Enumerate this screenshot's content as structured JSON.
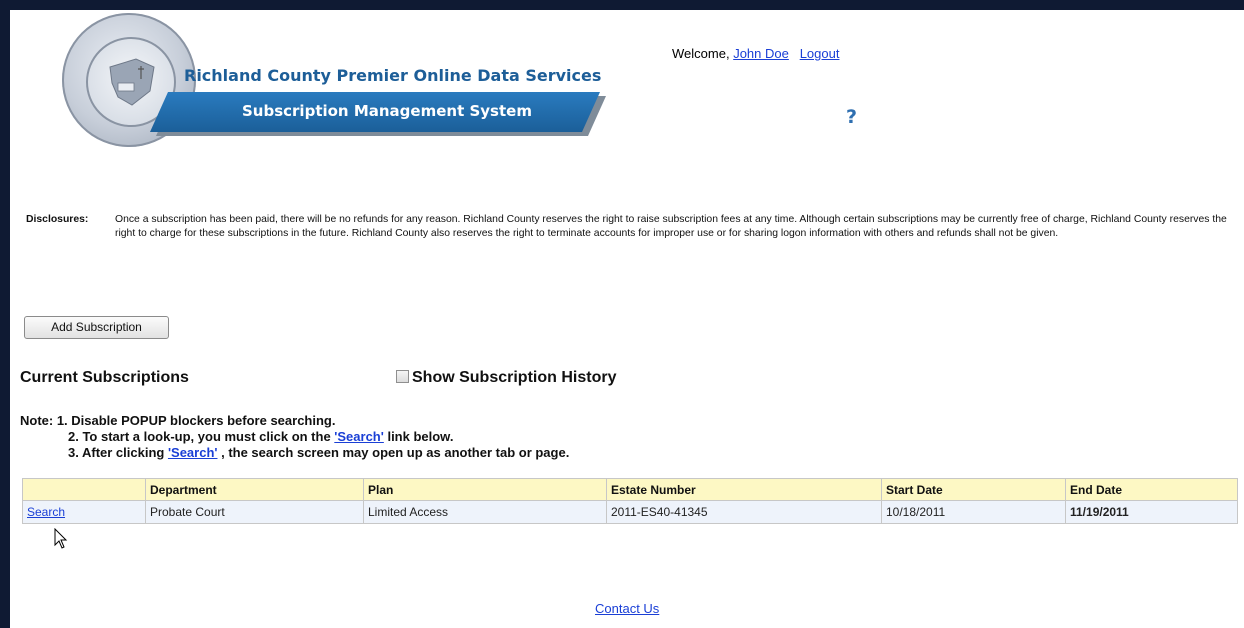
{
  "header": {
    "title_line1": "Richland County Premier Online Data Services",
    "title_line2": "Subscription Management System",
    "welcome_prefix": "Welcome,",
    "user_name": "John Doe",
    "logout_label": "Logout",
    "help_label": "?"
  },
  "disclosures": {
    "label": "Disclosures:",
    "text": "Once a subscription has been paid, there will be no refunds for any reason. Richland County reserves the right to raise subscription fees at any time. Although certain subscriptions may be currently free of charge, Richland County reserves the right to charge for these subscriptions in the future. Richland County also reserves the right to terminate accounts for improper use or for sharing logon information with others and refunds shall not be given."
  },
  "actions": {
    "add_subscription_label": "Add Subscription"
  },
  "section": {
    "current_title": "Current Subscriptions",
    "history_label": "Show Subscription History"
  },
  "notes": {
    "line1": "Note: 1. Disable POPUP blockers before searching.",
    "line2_pre": "2. To start a look-up, you must click on the ",
    "line2_link": "'Search'",
    "line2_post": " link below.",
    "line3_pre": "3. After clicking ",
    "line3_link": "'Search'",
    "line3_post": " , the search screen may open up as another tab or page."
  },
  "table": {
    "headers": [
      "",
      "Department",
      "Plan",
      "Estate Number",
      "Start Date",
      "End Date"
    ],
    "rows": [
      {
        "action": "Search",
        "department": "Probate Court",
        "plan": "Limited Access",
        "estate_number": "2011-ES40-41345",
        "start_date": "10/18/2011",
        "end_date": "11/19/2011"
      }
    ]
  },
  "footer": {
    "contact_label": "Contact Us"
  },
  "colors": {
    "frame": "#0f1a33",
    "banner": "#1b5f99",
    "link": "#1a3fd6",
    "header_row": "#fdf8c4",
    "data_row": "#eef3fb"
  },
  "icons": {
    "seal": "county-seal-icon",
    "cursor": "mouse-pointer-icon"
  }
}
